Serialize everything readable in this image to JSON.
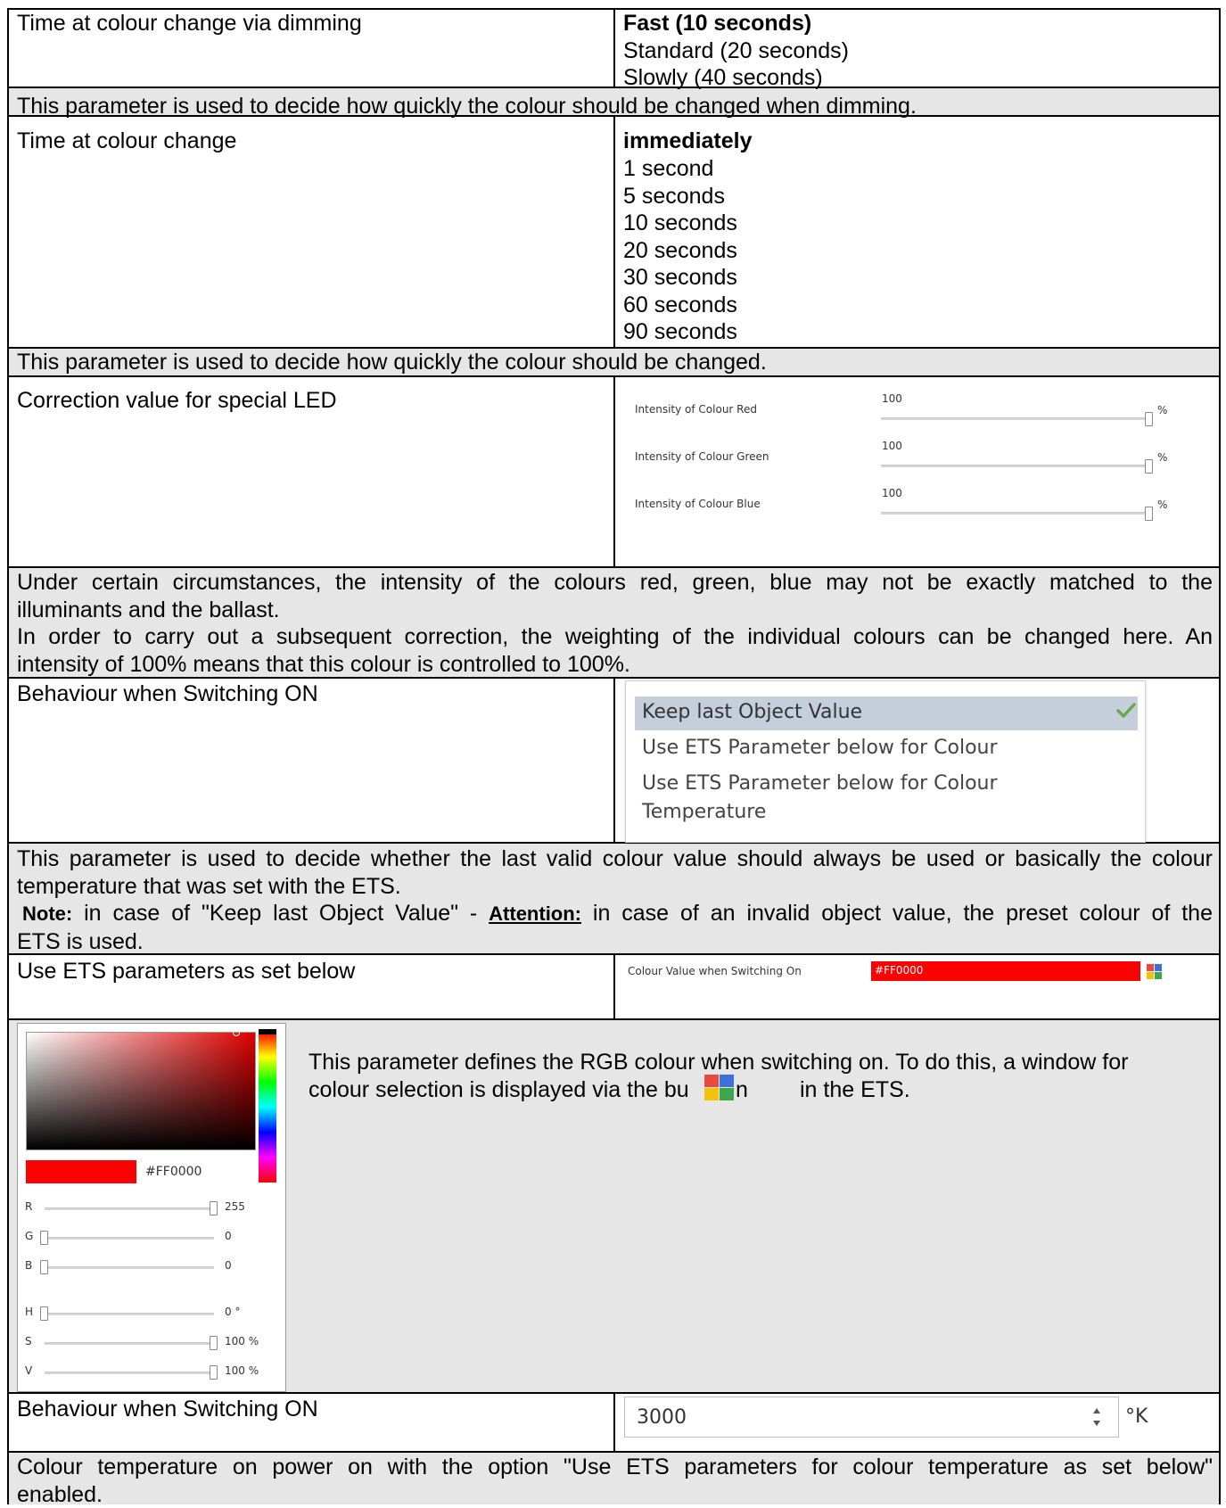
{
  "rows": [
    {
      "label": "Time at colour change via dimming",
      "options": [
        {
          "text": "Fast (10 seconds)",
          "bold": true
        },
        {
          "text": "Standard (20 seconds)"
        },
        {
          "text": "Slowly (40 seconds)"
        }
      ],
      "description": "This parameter is used to decide how quickly the colour should be changed when dimming."
    },
    {
      "label": "Time at colour change",
      "options": [
        {
          "text": "immediately",
          "bold": true
        },
        {
          "text": "1 second"
        },
        {
          "text": "5 seconds"
        },
        {
          "text": "10 seconds"
        },
        {
          "text": "20 seconds"
        },
        {
          "text": "30 seconds"
        },
        {
          "text": "60 seconds"
        },
        {
          "text": "90 seconds"
        }
      ],
      "description": "This parameter is used to decide how quickly the colour should be changed."
    },
    {
      "label": "Correction value for special LED",
      "description_lines": [
        "Under certain circumstances, the intensity of the colours red, green, blue may not be exactly matched to the",
        "illuminants and the ballast.",
        "In order to carry out a subsequent correction, the weighting of the individual colours can be changed here. An",
        "intensity of 100% means that this colour is controlled to 100%."
      ]
    },
    {
      "label": "Behaviour when Switching ON",
      "description_lines": [
        "This parameter is used to decide whether the last valid colour value should always be used or basically the colour",
        "temperature that was set with the ETS."
      ],
      "note_prefix": "Note:",
      "note_mid": " in case of \"Keep last Object Value\" - ",
      "attention": "Attention:",
      "note_rest": " in case of an invalid object value, the preset colour of the",
      "note_last": "ETS is used."
    },
    {
      "label": "Use ETS parameters as set below"
    },
    {
      "label": "Behaviour when Switching ON",
      "description_lines": [
        "Colour temperature on power on with the option \"Use ETS parameters for colour temperature as set below\"",
        "enabled."
      ]
    }
  ],
  "led_correction": {
    "sliders": [
      {
        "label": "Intensity of Colour Red",
        "value": "100",
        "unit": "%",
        "level": 1.0
      },
      {
        "label": "Intensity of Colour Green",
        "value": "100",
        "unit": "%",
        "level": 1.0
      },
      {
        "label": "Intensity of Colour Blue",
        "value": "100",
        "unit": "%",
        "level": 1.0
      }
    ]
  },
  "switch_on_dropdown": {
    "items": [
      "Keep last Object Value",
      "Use ETS Parameter below for Colour",
      "Use ETS Parameter below for Colour",
      "Temperature"
    ],
    "selected_index": 0
  },
  "colour_value": {
    "label": "Colour Value when Switching On",
    "value": "#FF0000",
    "color": "#ff0000"
  },
  "picker": {
    "hex": "#FF0000",
    "channels": [
      {
        "name": "R",
        "value": "255",
        "level": 1.0
      },
      {
        "name": "G",
        "value": "0",
        "level": 0.0
      },
      {
        "name": "B",
        "value": "0",
        "level": 0.0
      },
      {
        "name": "H",
        "value": "0 °",
        "level": 0.0
      },
      {
        "name": "S",
        "value": "100 %",
        "level": 1.0
      },
      {
        "name": "V",
        "value": "100 %",
        "level": 1.0
      }
    ],
    "text_line1": "This parameter defines the RGB colour when switching on. To do this, a window for",
    "text_line2_a": "colour selection is displayed via the bu",
    "text_line2_b": "n",
    "text_line2_c": "in the ETS."
  },
  "colour_temperature": {
    "value": "3000",
    "unit": "°K"
  }
}
